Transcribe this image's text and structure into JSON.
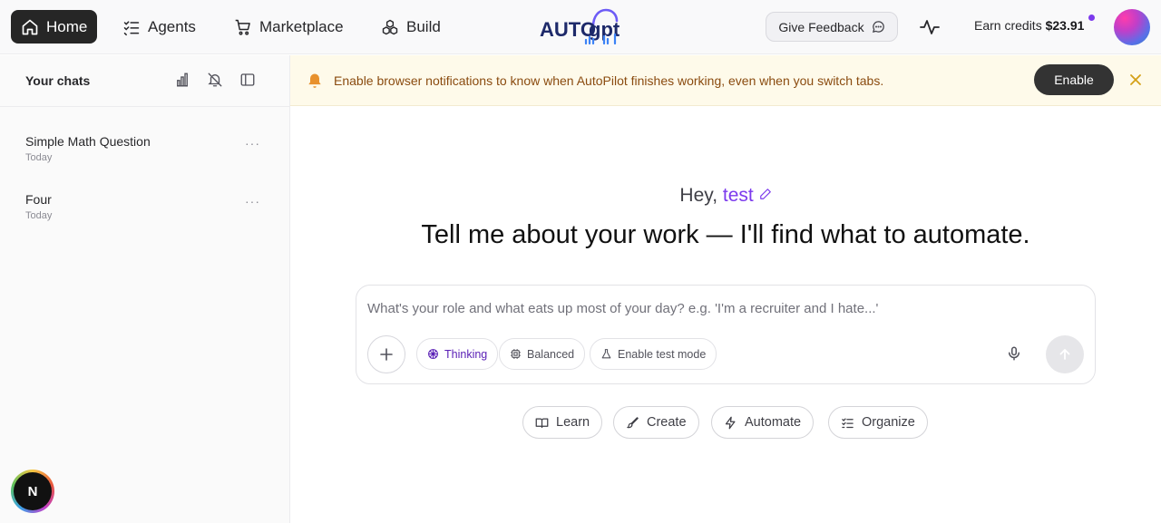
{
  "nav": {
    "home": "Home",
    "agents": "Agents",
    "marketplace": "Marketplace",
    "build": "Build"
  },
  "header": {
    "feedback_label": "Give Feedback",
    "credits_label": "Earn credits",
    "credits_value": "$23.91"
  },
  "sidebar": {
    "title": "Your chats",
    "chats": [
      {
        "title": "Simple Math Question",
        "date": "Today"
      },
      {
        "title": "Four",
        "date": "Today"
      }
    ],
    "badge": "N"
  },
  "banner": {
    "text": "Enable browser notifications to know when AutoPilot finishes working, even when you switch tabs.",
    "enable_label": "Enable"
  },
  "main": {
    "greeting_prefix": "Hey,",
    "user_name": "test",
    "headline": "Tell me about your work — I'll find what to automate.",
    "composer": {
      "placeholder": "What's your role and what eats up most of your day? e.g. 'I'm a recruiter and I hate...'",
      "value": "",
      "modes": [
        "Thinking",
        "Balanced",
        "Enable test mode"
      ]
    },
    "chips": [
      "Learn",
      "Create",
      "Automate",
      "Organize"
    ]
  },
  "colors": {
    "accent": "#7c3aed",
    "nav_active_bg": "#262626",
    "banner_bg": "#fefaea",
    "banner_text": "#8a4b0f"
  }
}
